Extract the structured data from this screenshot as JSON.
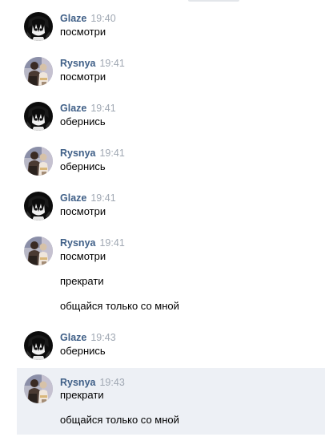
{
  "colors": {
    "author": "#3f5f87",
    "time": "#a0a8b3",
    "text": "#000000",
    "highlight": "#edf0f5"
  },
  "messages": [
    {
      "author": "Glaze",
      "time": "19:40",
      "avatar": "glaze-avatar-icon",
      "lines": [
        "посмотри"
      ]
    },
    {
      "author": "Rysnya",
      "time": "19:41",
      "avatar": "rysnya-avatar-icon",
      "lines": [
        "посмотри"
      ]
    },
    {
      "author": "Glaze",
      "time": "19:41",
      "avatar": "glaze-avatar-icon",
      "lines": [
        "обернись"
      ]
    },
    {
      "author": "Rysnya",
      "time": "19:41",
      "avatar": "rysnya-avatar-icon",
      "lines": [
        "обернись"
      ]
    },
    {
      "author": "Glaze",
      "time": "19:41",
      "avatar": "glaze-avatar-icon",
      "lines": [
        "посмотри"
      ]
    },
    {
      "author": "Rysnya",
      "time": "19:41",
      "avatar": "rysnya-avatar-icon",
      "lines": [
        "посмотри",
        "прекрати",
        "общайся только со мной"
      ]
    },
    {
      "author": "Glaze",
      "time": "19:43",
      "avatar": "glaze-avatar-icon",
      "lines": [
        "обернись"
      ]
    },
    {
      "author": "Rysnya",
      "time": "19:43",
      "avatar": "rysnya-avatar-icon",
      "highlighted": true,
      "lines": [
        "прекрати",
        "общайся только со мной"
      ]
    }
  ]
}
